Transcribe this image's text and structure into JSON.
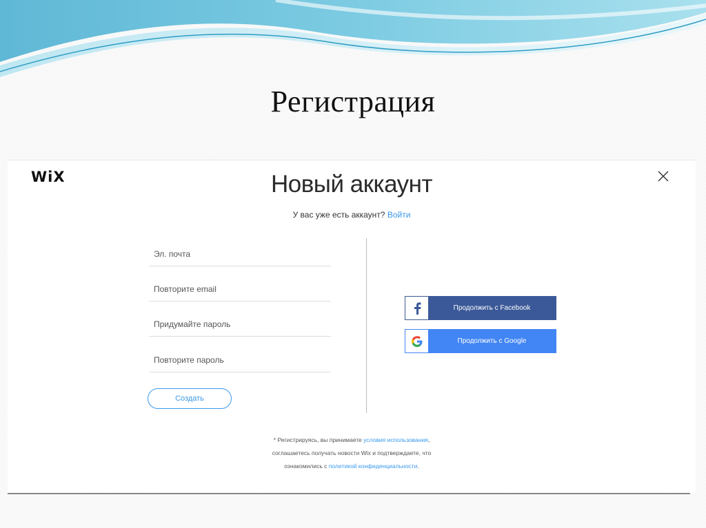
{
  "slide": {
    "title": "Регистрация"
  },
  "signup": {
    "logo": "WiX",
    "heading": "Новый аккаунт",
    "have_account_text": "У вас уже есть аккаунт?",
    "login_link": "Войти",
    "fields": {
      "email_placeholder": "Эл. почта",
      "email_repeat_placeholder": "Повторите email",
      "password_placeholder": "Придумайте пароль",
      "password_repeat_placeholder": "Повторите пароль"
    },
    "create_button": "Создать",
    "facebook_button": "Продолжить с Facebook",
    "google_button": "Продолжить с Google",
    "terms": {
      "part1": "* Регистрируясь, вы принимаете",
      "terms_link": "условия использования",
      "part2": ",",
      "part3": "соглашаетесь получать новости Wix и подтверждаете, что",
      "part4": "ознакомились с",
      "privacy_link": "политикой конфиденциальности",
      "part5": "."
    },
    "colors": {
      "accent": "#3899ec",
      "facebook": "#3b5998",
      "google": "#4285f4"
    },
    "icons": {
      "close": "close-icon",
      "facebook": "facebook-icon",
      "google": "google-icon"
    }
  }
}
